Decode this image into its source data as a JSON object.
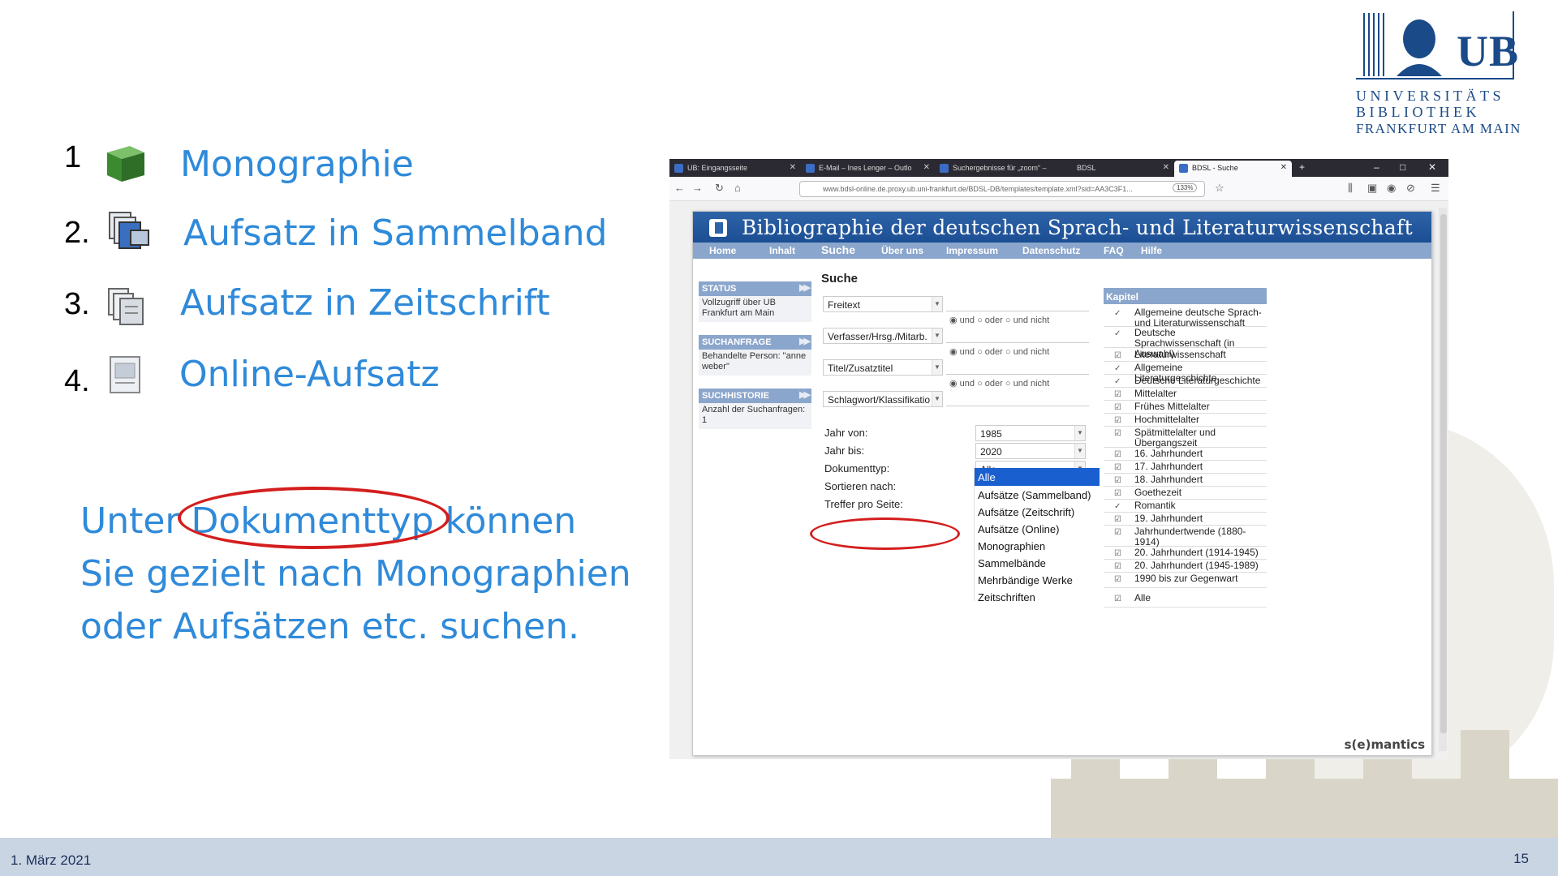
{
  "logo": {
    "abbr": "UB",
    "line1": "UNIVERSITÄTS",
    "line2": "BIBLIOTHEK",
    "line3": "FRANKFURT AM MAIN"
  },
  "doc_types": [
    {
      "number": "1",
      "label": "Monographie",
      "icon": "book-icon",
      "color": "#4a9c3c"
    },
    {
      "number": "2.",
      "label": "Aufsatz in Sammelband",
      "icon": "stacked-documents-icon",
      "color": "#3a6fbf"
    },
    {
      "number": "3.",
      "label": "Aufsatz in Zeitschrift",
      "icon": "journal-pages-icon",
      "color": "#8a96a8"
    },
    {
      "number": "4.",
      "label": "Online-Aufsatz",
      "icon": "online-document-icon",
      "color": "#9aa4b2"
    }
  ],
  "paragraph": {
    "line1": "Unter Dokumenttyp können",
    "line2": "Sie gezielt nach Monographien",
    "line3": "oder Aufsätzen etc. suchen."
  },
  "browser": {
    "tabs": [
      "UB: Eingangsseite",
      "E-Mail – Ines Lenger – Outlo",
      "Suchergebnisse für „zoom“ –",
      "BDSL",
      "BDSL - Suche"
    ],
    "url": "www.bdsl-online.de.proxy.ub.uni-frankfurt.de/BDSL-DB/templates/template.xml?sid=AA3C3F1...",
    "zoom": "133%"
  },
  "site": {
    "title": "Bibliographie der deutschen Sprach- und Literaturwissenschaft",
    "menu": [
      "Home",
      "Inhalt",
      "Suche",
      "Über uns",
      "Impressum",
      "Datenschutz",
      "FAQ",
      "Hilfe"
    ],
    "status": {
      "head": "STATUS",
      "body": "Vollzugriff über UB Frankfurt am Main"
    },
    "suchanfrage": {
      "head": "SUCHANFRAGE",
      "body": "Behandelte Person: \"anne weber\""
    },
    "suchhistorie": {
      "head": "SUCHHISTORIE",
      "body": "Anzahl der Suchanfragen: 1"
    },
    "search": {
      "title": "Suche",
      "fields": [
        "Freitext",
        "Verfasser/Hrsg./Mitarb.",
        "Titel/Zusatztitel",
        "Schlagwort/Klassifikatio"
      ],
      "radio_und": "und",
      "radio_oder": "oder",
      "radio_nicht": "und nicht",
      "year_from_label": "Jahr von:",
      "year_from": "1985",
      "year_to_label": "Jahr bis:",
      "year_to": "2020",
      "doctype_label": "Dokumenttyp:",
      "doctype_value": "Alle",
      "sort_label": "Sortieren nach:",
      "hits_label": "Treffer pro Seite:",
      "doctype_options": [
        "Alle",
        "Aufsätze (Sammelband)",
        "Aufsätze (Zeitschrift)",
        "Aufsätze (Online)",
        "Monographien",
        "Sammelbände",
        "Mehrbändige Werke",
        "Zeitschriften"
      ]
    },
    "kapitel": {
      "head": "Kapitel",
      "items": [
        "Allgemeine deutsche Sprach- und Literaturwissenschaft",
        "Deutsche Sprachwissenschaft (in Auswahl)",
        "Literaturwissenschaft",
        "Allgemeine Literaturgeschichte",
        "Deutsche Literaturgeschichte",
        "Mittelalter",
        "Frühes Mittelalter",
        "Hochmittelalter",
        "Spätmittelalter und Übergangszeit",
        "16. Jahrhundert",
        "17. Jahrhundert",
        "18. Jahrhundert",
        "Goethezeit",
        "Romantik",
        "19. Jahrhundert",
        "Jahrhundertwende (1880-1914)",
        "20. Jahrhundert (1914-1945)",
        "20. Jahrhundert (1945-1989)",
        "1990 bis zur Gegenwart",
        "Alle"
      ]
    },
    "brand": "s(e)mantics"
  },
  "footer": {
    "date": "1. März 2021",
    "page": "15"
  },
  "colors": {
    "accent_text": "#2f8ad9",
    "highlight_ellipse": "#d41e1e",
    "banner": "#1b4e93",
    "footer": "#cad5e4"
  }
}
